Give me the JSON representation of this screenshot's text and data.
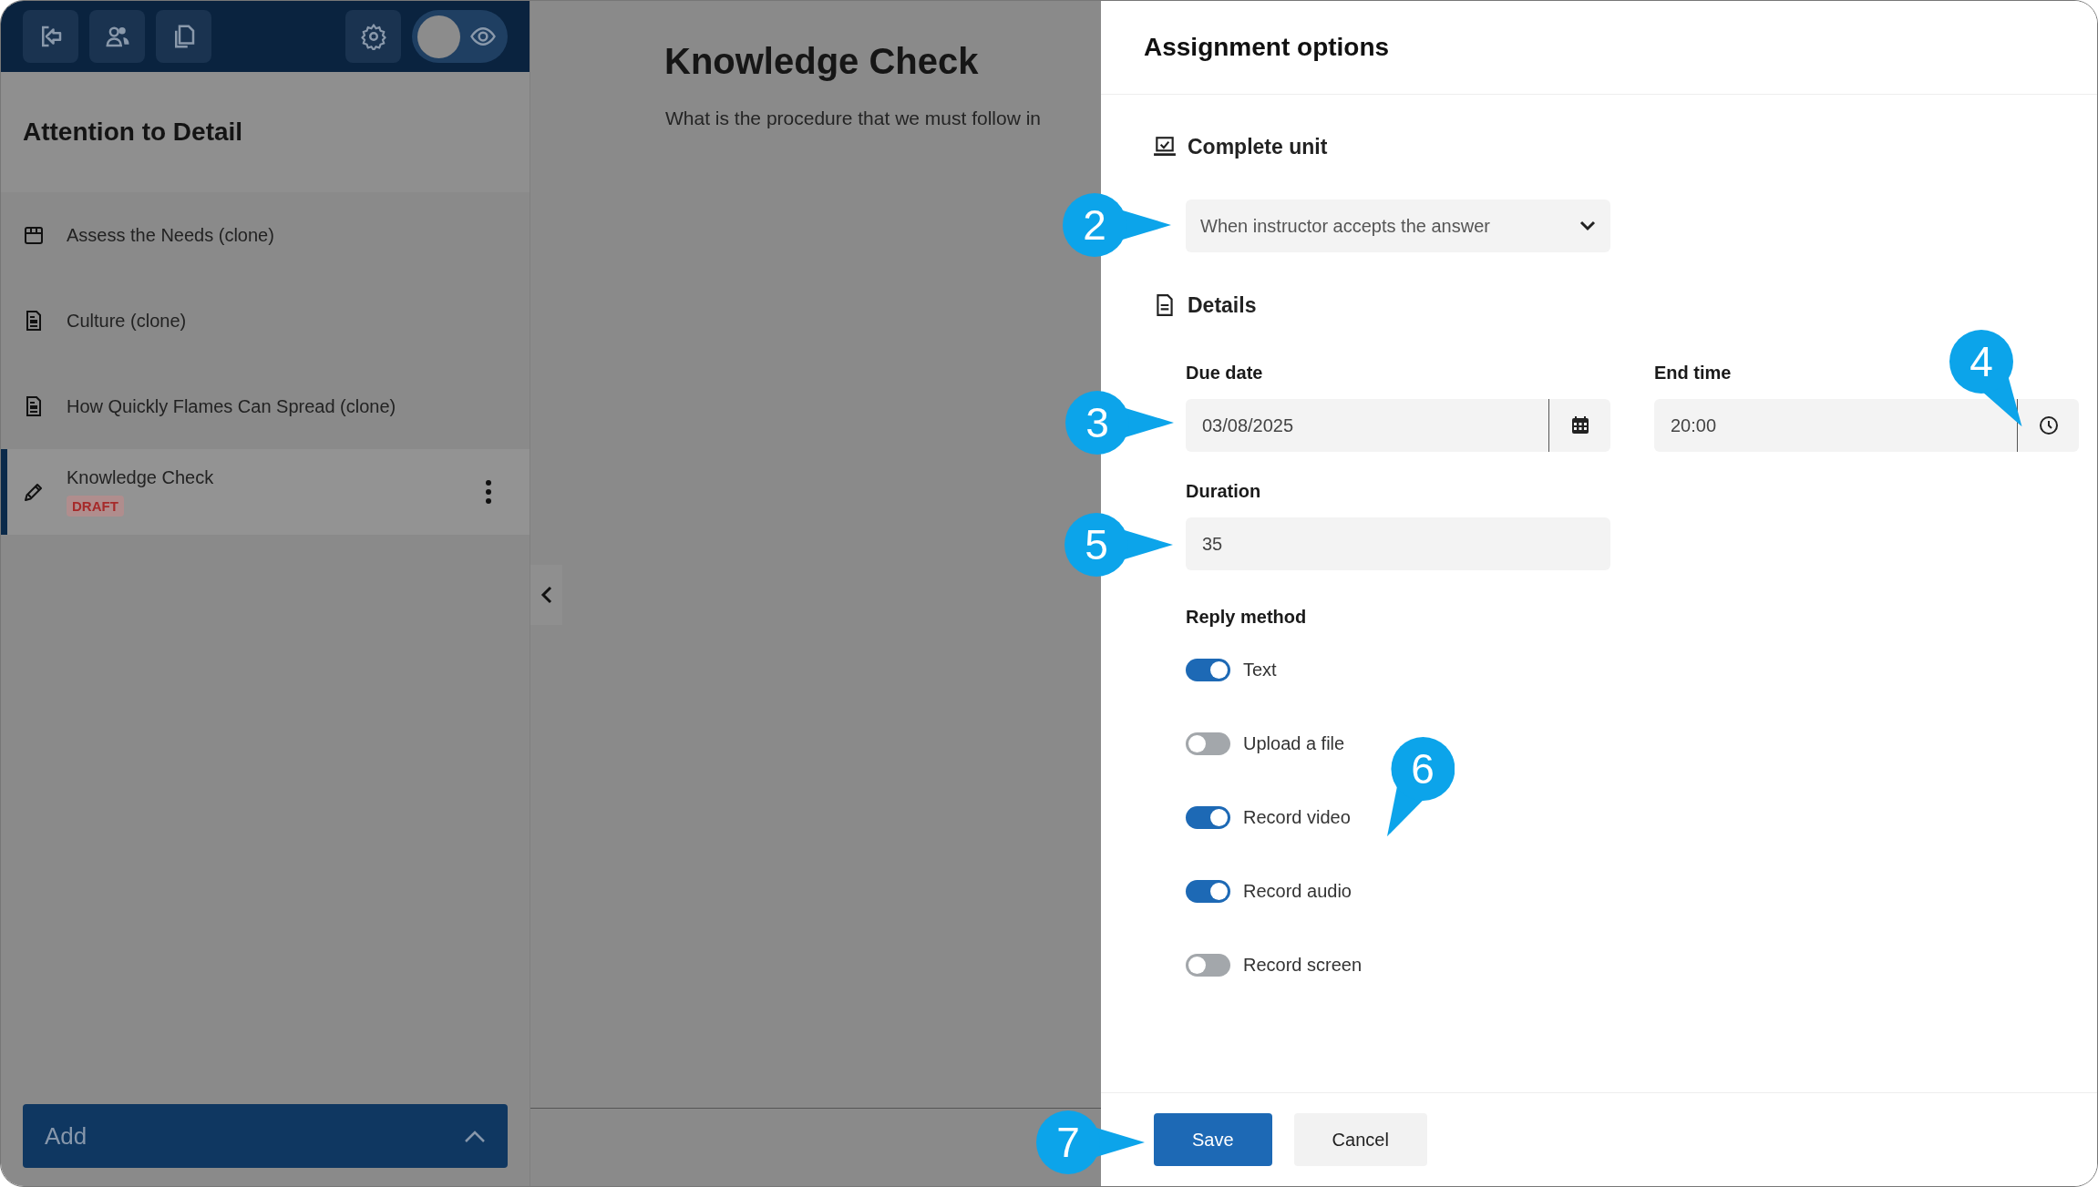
{
  "sidebar": {
    "header_buttons": [
      {
        "kind": "exit"
      },
      {
        "kind": "users"
      },
      {
        "kind": "copy"
      },
      {
        "kind": "settings"
      }
    ],
    "preview_toggle": {
      "on": false
    },
    "title": "Attention to Detail",
    "items": [
      {
        "kind": "event",
        "label": "Assess the Needs (clone)",
        "selected": false
      },
      {
        "kind": "document",
        "label": "Culture (clone)",
        "selected": false
      },
      {
        "kind": "document",
        "label": "How Quickly Flames Can Spread (clone)",
        "selected": false
      },
      {
        "kind": "edit",
        "label": "Knowledge Check",
        "badge": "DRAFT",
        "selected": true
      }
    ],
    "add_button": "Add"
  },
  "main": {
    "title": "Knowledge Check",
    "question": "What is the procedure that we must follow in"
  },
  "panel": {
    "title": "Assignment options",
    "complete_unit": {
      "heading": "Complete unit",
      "value": "When instructor accepts the answer"
    },
    "details": {
      "heading": "Details",
      "due_date": {
        "label": "Due date",
        "value": "03/08/2025"
      },
      "end_time": {
        "label": "End time",
        "value": "20:00"
      },
      "duration": {
        "label": "Duration",
        "value": "35"
      }
    },
    "reply_method": {
      "label": "Reply method",
      "options": [
        {
          "label": "Text",
          "on": true
        },
        {
          "label": "Upload a file",
          "on": false
        },
        {
          "label": "Record video",
          "on": true
        },
        {
          "label": "Record audio",
          "on": true
        },
        {
          "label": "Record screen",
          "on": false
        }
      ]
    },
    "buttons": [
      {
        "kind": "primary",
        "label": "Save"
      },
      {
        "kind": "secondary",
        "label": "Cancel"
      }
    ]
  },
  "callouts": [
    {
      "number": "2",
      "kind": "right"
    },
    {
      "number": "3",
      "kind": "right"
    },
    {
      "number": "4",
      "kind": "downright"
    },
    {
      "number": "5",
      "kind": "right"
    },
    {
      "number": "6",
      "kind": "downleft"
    },
    {
      "number": "7",
      "kind": "right"
    }
  ]
}
